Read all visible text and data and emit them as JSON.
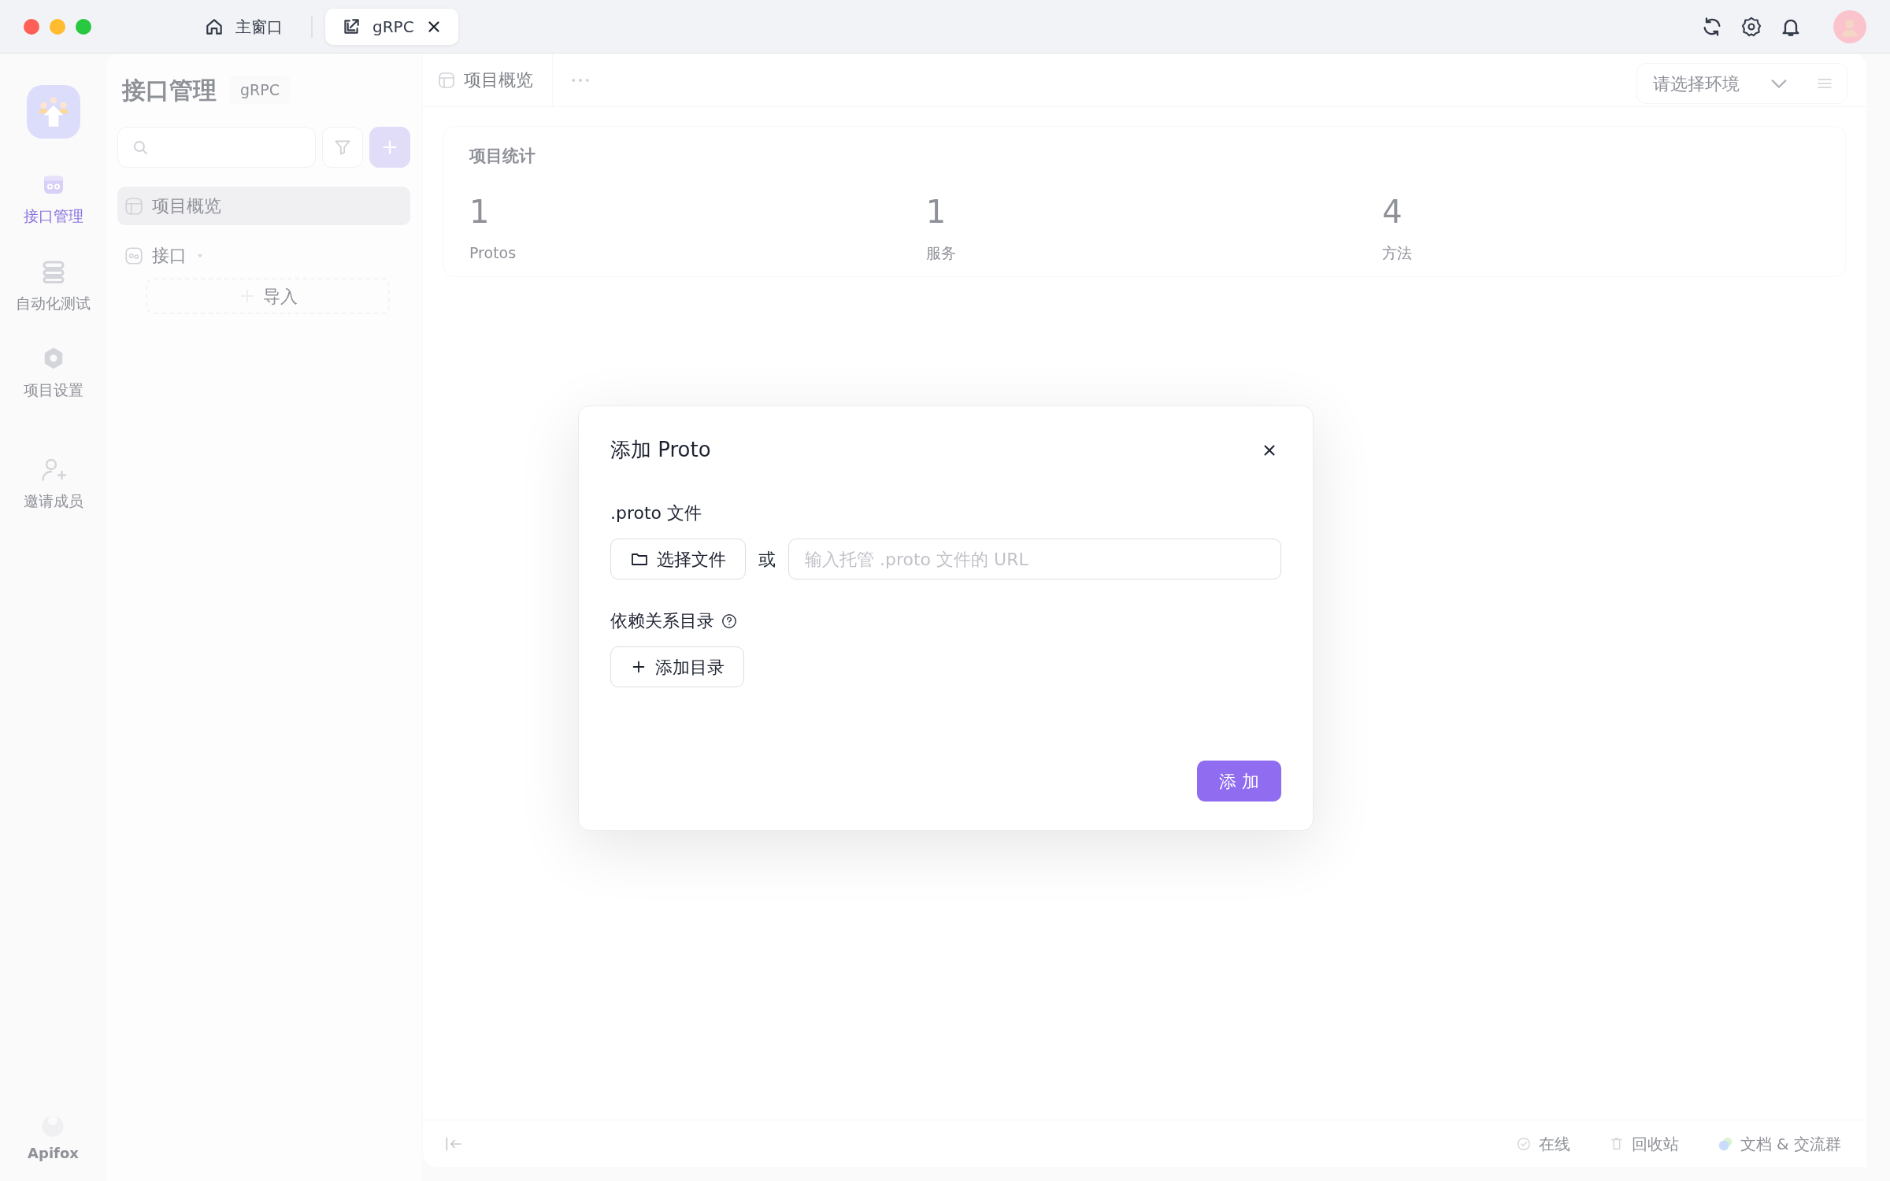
{
  "window": {
    "tabs": [
      {
        "label": "主窗口",
        "kind": "home",
        "selected": false,
        "closable": false
      },
      {
        "label": "gRPC",
        "kind": "external",
        "selected": true,
        "closable": true
      }
    ]
  },
  "nav_rail": {
    "items": [
      {
        "label": "接口管理",
        "kind": "api",
        "selected": true
      },
      {
        "label": "自动化测试",
        "kind": "test",
        "selected": false
      },
      {
        "label": "项目设置",
        "kind": "settings",
        "selected": false
      },
      {
        "label": "邀请成员",
        "kind": "invite",
        "selected": false
      }
    ],
    "brand": "Apifox"
  },
  "sidebar": {
    "title": "接口管理",
    "tag": "gRPC",
    "items": [
      {
        "label": "项目概览",
        "kind": "overview",
        "selected": true
      },
      {
        "label": "接口",
        "kind": "api",
        "selected": false
      }
    ],
    "import_button": "导入"
  },
  "main": {
    "tabs": [
      {
        "label": "项目概览",
        "selected": true
      }
    ],
    "environment_select": {
      "placeholder": "请选择环境"
    },
    "stats": {
      "title": "项目统计",
      "items": [
        {
          "value": "1",
          "label": "Protos"
        },
        {
          "value": "1",
          "label": "服务"
        },
        {
          "value": "4",
          "label": "方法"
        }
      ]
    },
    "status_bar": [
      {
        "label": "在线",
        "kind": "online"
      },
      {
        "label": "回收站",
        "kind": "trash"
      },
      {
        "label": "文档 & 交流群",
        "kind": "chat"
      }
    ]
  },
  "dialog": {
    "title": "添加 Proto",
    "proto_label": ".proto 文件",
    "choose_button": "选择文件",
    "or": "或",
    "url_placeholder": "输入托管 .proto 文件的 URL",
    "deps_label": "依赖关系目录",
    "add_dir_button": "添加目录",
    "submit": "添 加"
  }
}
